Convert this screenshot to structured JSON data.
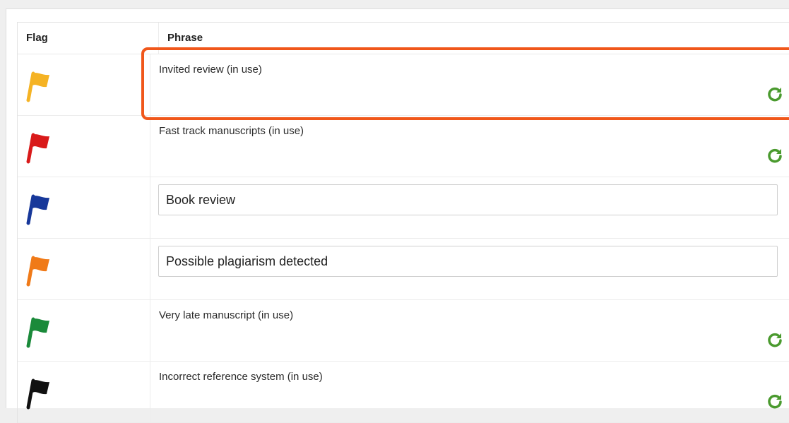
{
  "table": {
    "headers": {
      "flag": "Flag",
      "phrase": "Phrase"
    },
    "rows": [
      {
        "flag_color": "#f5b324",
        "type": "text",
        "phrase": "Invited review (in use)",
        "icon": "refresh-icon"
      },
      {
        "flag_color": "#d91a1a",
        "type": "text",
        "phrase": "Fast track manuscripts (in use)",
        "icon": "refresh-icon"
      },
      {
        "flag_color": "#17389a",
        "type": "input",
        "phrase": "Book review"
      },
      {
        "flag_color": "#f07a18",
        "type": "input",
        "phrase": "Possible plagiarism detected"
      },
      {
        "flag_color": "#1a8a3a",
        "type": "text",
        "phrase": "Very late manuscript (in use)",
        "icon": "refresh-icon"
      },
      {
        "flag_color": "#111111",
        "type": "text",
        "phrase": "Incorrect reference system (in use)",
        "icon": "refresh-icon"
      }
    ]
  },
  "colors": {
    "refresh_icon": "#4a9a2e",
    "highlight_border": "#f0571b"
  }
}
